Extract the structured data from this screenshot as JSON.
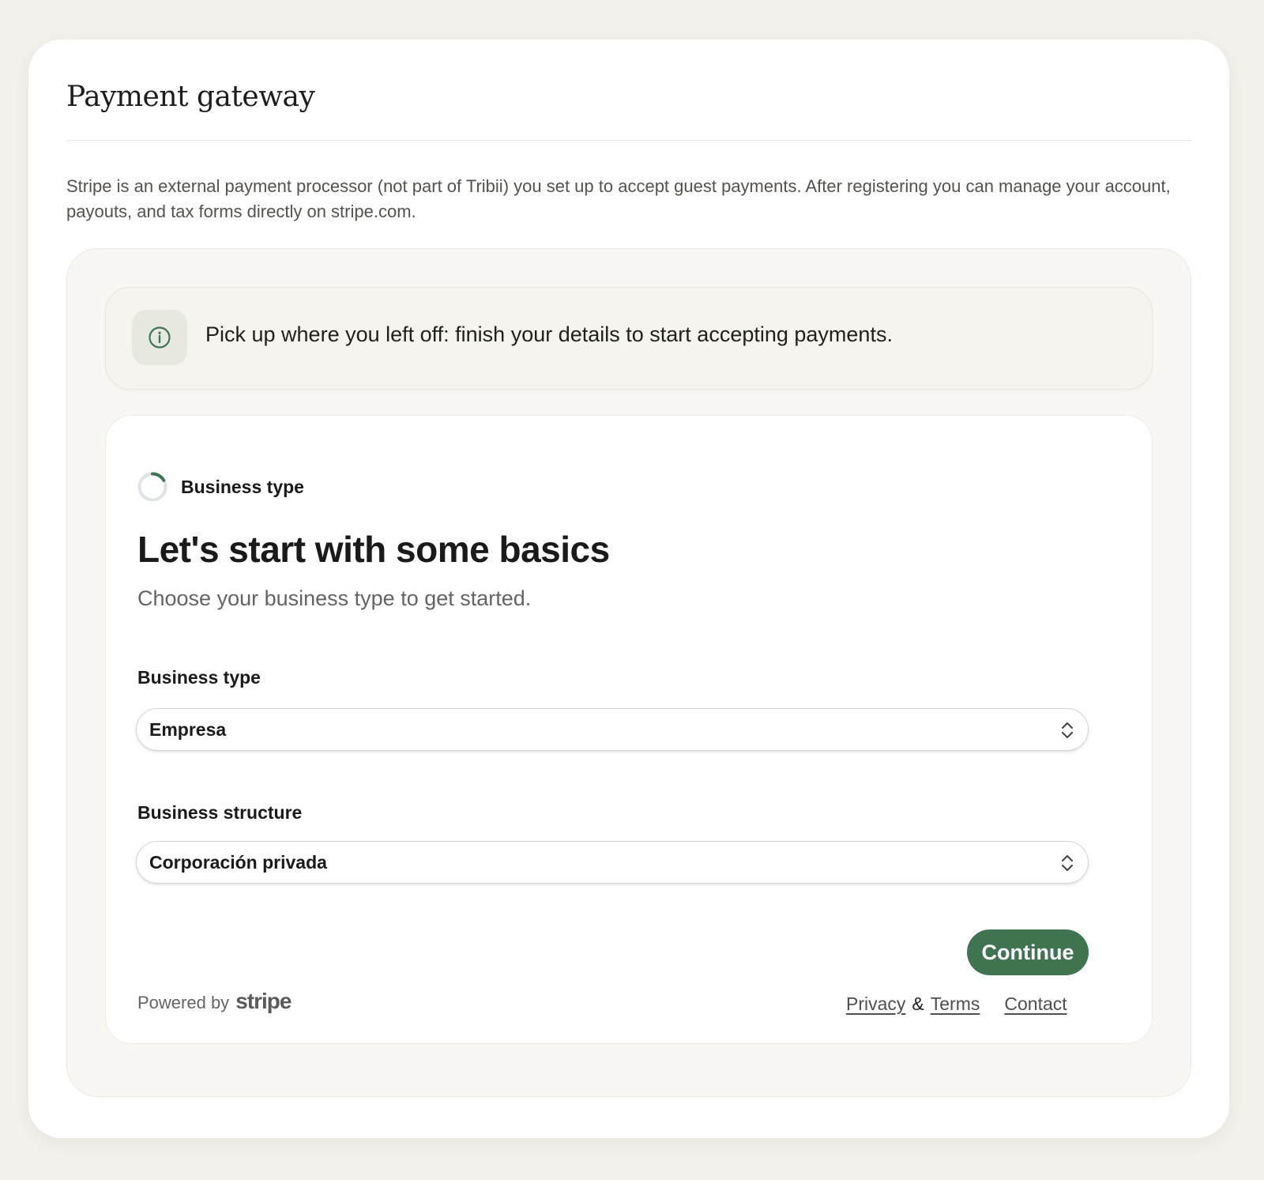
{
  "page": {
    "title": "Payment gateway",
    "intro": "Stripe is an external payment processor (not part of Tribii) you set up to accept guest payments. After registering you can manage your account, payouts, and tax forms directly on stripe.com."
  },
  "notice": {
    "icon": "info-icon",
    "text": "Pick up where you left off: finish your details to start accepting payments."
  },
  "form": {
    "step_label": "Business type",
    "heading": "Let's start with some basics",
    "subheading": "Choose your business type to get started.",
    "fields": [
      {
        "label": "Business type",
        "value": "Empresa",
        "icon": "chevron-up-down-icon"
      },
      {
        "label": "Business structure",
        "value": "Corporación privada",
        "icon": "chevron-up-down-icon"
      }
    ],
    "continue_label": "Continue"
  },
  "footer": {
    "powered_by": "Powered by",
    "brand": "stripe",
    "privacy_label": "Privacy",
    "amp": "&",
    "terms_label": "Terms",
    "contact_label": "Contact"
  },
  "colors": {
    "accent": "#3f7451",
    "background": "#f3f1ec"
  }
}
